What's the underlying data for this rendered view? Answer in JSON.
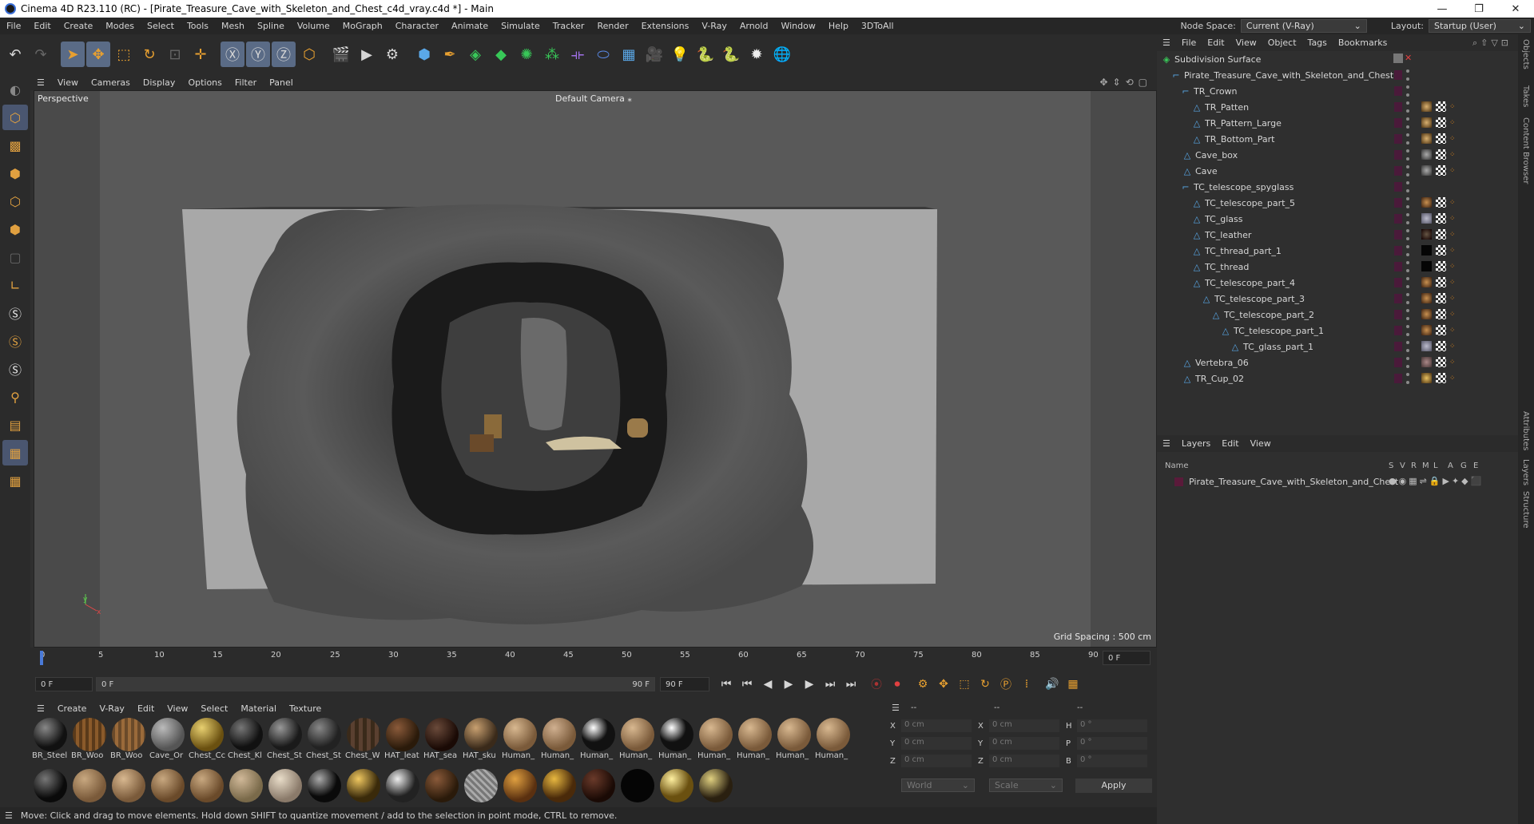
{
  "window": {
    "title": "Cinema 4D R23.110 (RC) - [Pirate_Treasure_Cave_with_Skeleton_and_Chest_c4d_vray.c4d *] - Main",
    "min": "—",
    "max": "❐",
    "close": "✕"
  },
  "menubar": {
    "items": [
      "File",
      "Edit",
      "Create",
      "Modes",
      "Select",
      "Tools",
      "Mesh",
      "Spline",
      "Volume",
      "MoGraph",
      "Character",
      "Animate",
      "Simulate",
      "Tracker",
      "Render",
      "Extensions",
      "V-Ray",
      "Arnold",
      "Window",
      "Help",
      "3DToAll"
    ],
    "node_space_label": "Node Space:",
    "node_space_value": "Current (V-Ray)",
    "layout_label": "Layout:",
    "layout_value": "Startup (User)"
  },
  "viewport": {
    "menu": [
      "View",
      "Cameras",
      "Display",
      "Options",
      "Filter",
      "Panel"
    ],
    "label": "Perspective",
    "camera": "Default Camera",
    "grid_spacing": "Grid Spacing : 500 cm"
  },
  "timeline": {
    "ticks": [
      "0",
      "5",
      "10",
      "15",
      "20",
      "25",
      "30",
      "35",
      "40",
      "45",
      "50",
      "55",
      "60",
      "65",
      "70",
      "75",
      "80",
      "85",
      "90"
    ],
    "current_frame": "0 F"
  },
  "playback": {
    "start": "0 F",
    "range_start": "0 F",
    "range_end": "90 F",
    "end": "90 F"
  },
  "materials": {
    "menu": [
      "Create",
      "V-Ray",
      "Edit",
      "View",
      "Select",
      "Material",
      "Texture"
    ],
    "row1": [
      "BR_Steel",
      "BR_Woo",
      "BR_Woo",
      "Cave_Or",
      "Chest_Cc",
      "Chest_Kl",
      "Chest_St",
      "Chest_St",
      "Chest_W",
      "HAT_leat",
      "HAT_sea",
      "HAT_sku",
      "Human_",
      "Human_",
      "Human_",
      "Human_",
      "Human_",
      "Human_",
      "Human_",
      "Human_",
      "Human_"
    ]
  },
  "coordinates": {
    "x1": "0 cm",
    "y1": "0 cm",
    "z1": "0 cm",
    "x2": "0 cm",
    "y2": "0 cm",
    "z2": "0 cm",
    "h": "0 °",
    "p": "0 °",
    "b": "0 °",
    "dashes": "--",
    "world": "World",
    "scale": "Scale",
    "apply": "Apply"
  },
  "status": "Move: Click and drag to move elements. Hold down SHIFT to quantize movement / add to the selection in point mode, CTRL to remove.",
  "objects": {
    "menu": [
      "File",
      "Edit",
      "View",
      "Object",
      "Tags",
      "Bookmarks"
    ],
    "items": [
      {
        "name": "Subdivision Surface",
        "indent": 0
      },
      {
        "name": "Pirate_Treasure_Cave_with_Skeleton_and_Chest",
        "indent": 1
      },
      {
        "name": "TR_Crown",
        "indent": 2
      },
      {
        "name": "TR_Patten",
        "indent": 3
      },
      {
        "name": "TR_Pattern_Large",
        "indent": 3
      },
      {
        "name": "TR_Bottom_Part",
        "indent": 3
      },
      {
        "name": "Cave_box",
        "indent": 2
      },
      {
        "name": "Cave",
        "indent": 2
      },
      {
        "name": "TC_telescope_spyglass",
        "indent": 2
      },
      {
        "name": "TC_telescope_part_5",
        "indent": 3
      },
      {
        "name": "TC_glass",
        "indent": 3
      },
      {
        "name": "TC_leather",
        "indent": 3
      },
      {
        "name": "TC_thread_part_1",
        "indent": 3
      },
      {
        "name": "TC_thread",
        "indent": 3
      },
      {
        "name": "TC_telescope_part_4",
        "indent": 3
      },
      {
        "name": "TC_telescope_part_3",
        "indent": 4
      },
      {
        "name": "TC_telescope_part_2",
        "indent": 5
      },
      {
        "name": "TC_telescope_part_1",
        "indent": 6
      },
      {
        "name": "TC_glass_part_1",
        "indent": 7
      },
      {
        "name": "Vertebra_06",
        "indent": 2
      },
      {
        "name": "TR_Cup_02",
        "indent": 2
      }
    ]
  },
  "layers": {
    "menu": [
      "Layers",
      "Edit",
      "View"
    ],
    "col_name": "Name",
    "cols": [
      "S",
      "V",
      "R",
      "M",
      "L",
      "A",
      "G",
      "E"
    ],
    "row": "Pirate_Treasure_Cave_with_Skeleton_and_Chest"
  },
  "sidetabs": [
    "Objects",
    "Takes",
    "Content Browser",
    "Attributes",
    "Layers",
    "Structure"
  ]
}
